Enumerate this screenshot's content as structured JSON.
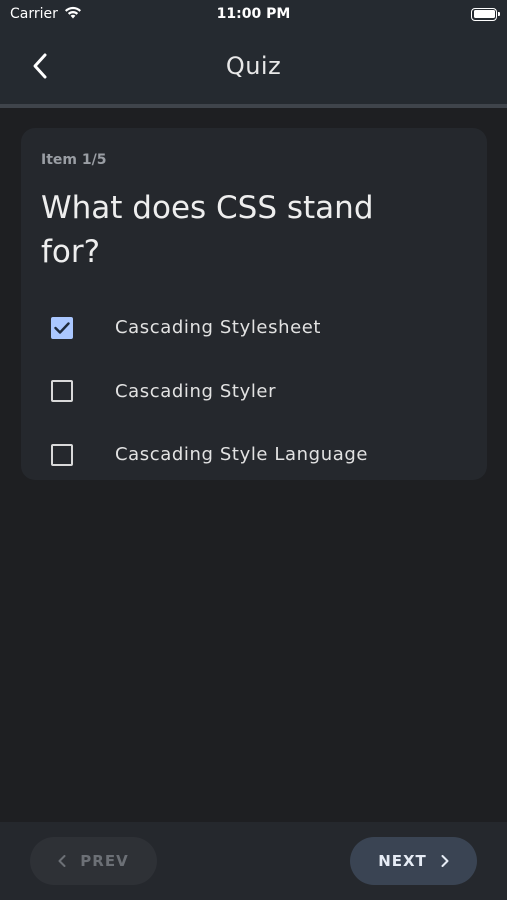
{
  "status_bar": {
    "carrier": "Carrier",
    "time": "11:00 PM"
  },
  "nav": {
    "title": "Quiz"
  },
  "quiz": {
    "counter": "Item 1/5",
    "question": "What does CSS stand for?",
    "options": [
      {
        "label": "Cascading Stylesheet",
        "checked": true
      },
      {
        "label": "Cascading Styler",
        "checked": false
      },
      {
        "label": "Cascading Style Language",
        "checked": false
      }
    ]
  },
  "footer": {
    "prev_label": "PREV",
    "next_label": "NEXT",
    "prev_enabled": false
  },
  "colors": {
    "accent": "#aac7ff",
    "background": "#1e1f22",
    "card": "#25282d"
  }
}
